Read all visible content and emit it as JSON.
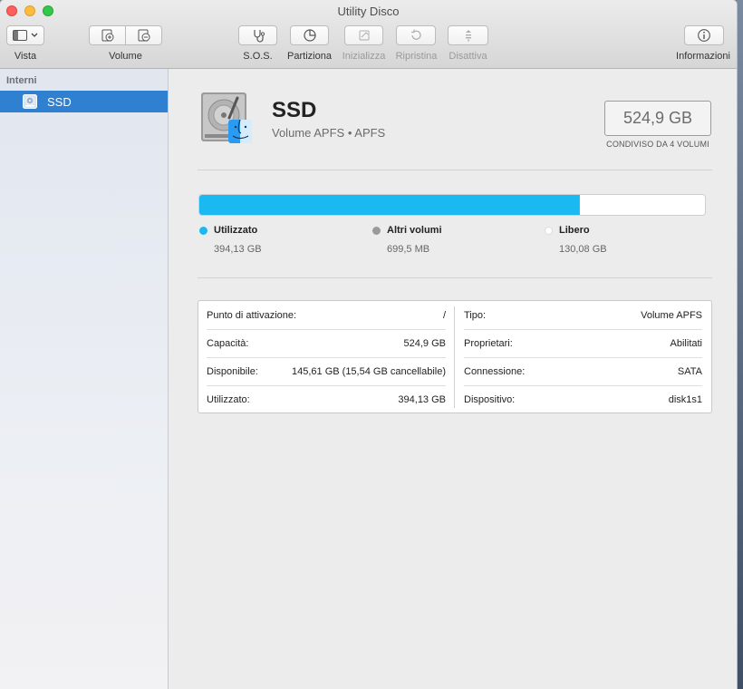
{
  "window": {
    "title": "Utility Disco"
  },
  "toolbar": {
    "vista": "Vista",
    "volume": "Volume",
    "sos": "S.O.S.",
    "partiziona": "Partiziona",
    "inizializza": "Inizializza",
    "ripristina": "Ripristina",
    "disattiva": "Disattiva",
    "informazioni": "Informazioni"
  },
  "sidebar": {
    "section": "Interni",
    "items": [
      {
        "label": "SSD",
        "selected": true
      }
    ]
  },
  "volume": {
    "name": "SSD",
    "subtitle": "Volume APFS • APFS",
    "capacity": "524,9 GB",
    "shared_note": "CONDIVISO DA 4 VOLUMI"
  },
  "usage": {
    "used_fraction": 0.7508,
    "other_fraction": 0.0013,
    "legend": [
      {
        "label": "Utilizzato",
        "value": "394,13 GB",
        "color": "#1ab9f1"
      },
      {
        "label": "Altri volumi",
        "value": "699,5 MB",
        "color": "#9a9a9a"
      },
      {
        "label": "Libero",
        "value": "130,08 GB",
        "color": "#ffffff"
      }
    ]
  },
  "info": {
    "left": [
      {
        "key": "Punto di attivazione:",
        "value": "/"
      },
      {
        "key": "Capacità:",
        "value": "524,9 GB"
      },
      {
        "key": "Disponibile:",
        "value": "145,61 GB (15,54 GB cancellabile)"
      },
      {
        "key": "Utilizzato:",
        "value": "394,13 GB"
      }
    ],
    "right": [
      {
        "key": "Tipo:",
        "value": "Volume APFS"
      },
      {
        "key": "Proprietari:",
        "value": "Abilitati"
      },
      {
        "key": "Connessione:",
        "value": "SATA"
      },
      {
        "key": "Dispositivo:",
        "value": "disk1s1"
      }
    ]
  }
}
